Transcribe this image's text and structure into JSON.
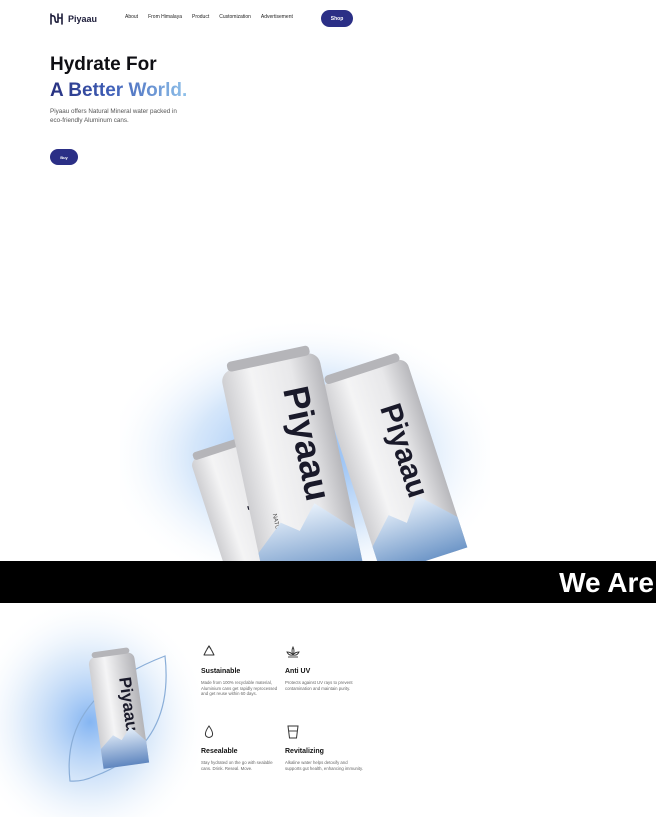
{
  "brand": {
    "name": "Piyaau"
  },
  "nav": {
    "links": [
      "About",
      "From Himalaya",
      "Product",
      "Customization",
      "Advertisement"
    ],
    "shop_label": "Shop"
  },
  "hero": {
    "title_line1": "Hydrate For",
    "title_line2": "A Better World.",
    "description": "Piyaau offers Natural Mineral water packed in eco-friendly Aluminum cans.",
    "buy_label": "Buy"
  },
  "banner": {
    "text": "We Are"
  },
  "can": {
    "brand": "Piyaau",
    "subtitle_1": "NATURAL",
    "subtitle_2": "MINERAL WATER"
  },
  "features": [
    {
      "icon": "recycle-icon",
      "title": "Sustainable",
      "description": "Made from 100% recyclable material, Aluminium cans get rapidly reprocessed and get reuse within 60 days."
    },
    {
      "icon": "lotus-icon",
      "title": "Anti UV",
      "description": "Protects against UV rays to prevent contamination and maintain purity."
    },
    {
      "icon": "droplet-icon",
      "title": "Resealable",
      "description": "Stay hydrated on the go with sealable cans. Drink. Reseal. Move."
    },
    {
      "icon": "glass-icon",
      "title": "Revitalizing",
      "description": "Alkaline water helps detoxify and supports gut health, enhancing immunity."
    }
  ],
  "colors": {
    "accent": "#2b2f86",
    "gradient_start": "#27307f",
    "gradient_end": "#8fc1ea",
    "banner_bg": "#000000"
  }
}
